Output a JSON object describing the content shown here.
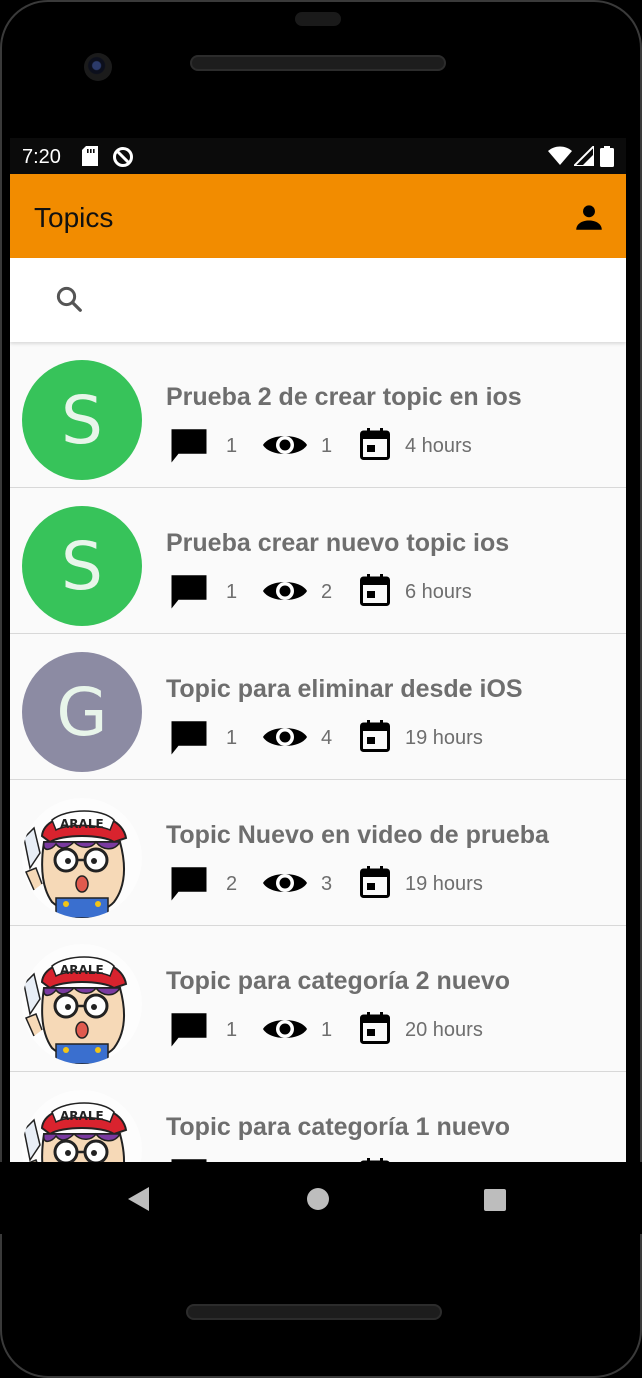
{
  "status_bar": {
    "time": "7:20"
  },
  "app_bar": {
    "title": "Topics"
  },
  "search": {
    "placeholder": "",
    "value": ""
  },
  "colors": {
    "accent": "#f28c00",
    "avatar_s": "#37c35a",
    "avatar_g": "#8c8ba3"
  },
  "topics": [
    {
      "title": "Prueba 2 de crear topic en ios",
      "avatar": "S",
      "comments": "1",
      "views": "1",
      "time": "4 hours"
    },
    {
      "title": "Prueba crear nuevo topic ios",
      "avatar": "S",
      "comments": "1",
      "views": "2",
      "time": "6 hours"
    },
    {
      "title": "Topic para eliminar desde iOS",
      "avatar": "G",
      "comments": "1",
      "views": "4",
      "time": "19 hours"
    },
    {
      "title": "Topic Nuevo en video de prueba",
      "avatar": "image",
      "comments": "2",
      "views": "3",
      "time": "19 hours"
    },
    {
      "title": "Topic para categoría 2 nuevo",
      "avatar": "image",
      "comments": "1",
      "views": "1",
      "time": "20 hours"
    },
    {
      "title": "Topic para categoría 1 nuevo",
      "avatar": "image",
      "comments": "",
      "views": "",
      "time": ""
    }
  ],
  "icons": {
    "comment": "comment-icon",
    "views": "eye-icon",
    "date": "calendar-icon",
    "profile": "person-icon",
    "search": "search-icon",
    "fab": "plus-icon"
  }
}
